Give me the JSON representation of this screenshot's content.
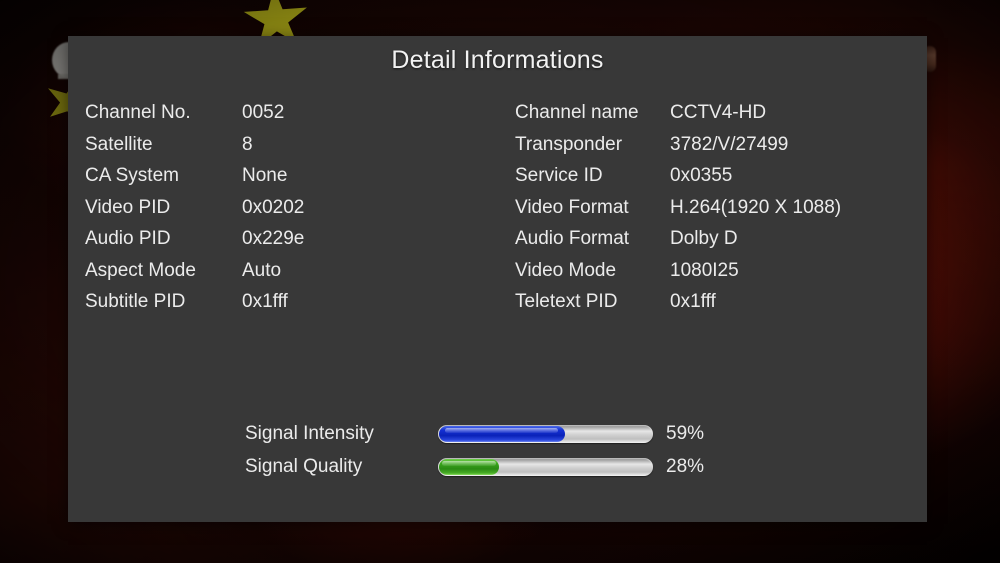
{
  "dialog": {
    "title": "Detail Informations"
  },
  "info": {
    "left": [
      {
        "label": "Channel No.",
        "value": "0052"
      },
      {
        "label": "Satellite",
        "value": "8"
      },
      {
        "label": "CA System",
        "value": "None"
      },
      {
        "label": "Video PID",
        "value": "0x0202"
      },
      {
        "label": "Audio PID",
        "value": "0x229e"
      },
      {
        "label": "Aspect Mode",
        "value": "Auto"
      },
      {
        "label": "Subtitle PID",
        "value": "0x1fff"
      }
    ],
    "right": [
      {
        "label": "Channel name",
        "value": "CCTV4-HD"
      },
      {
        "label": "Transponder",
        "value": "3782/V/27499"
      },
      {
        "label": "Service ID",
        "value": "0x0355"
      },
      {
        "label": "Video Format",
        "value": "H.264(1920 X 1088)"
      },
      {
        "label": "Audio Format",
        "value": "Dolby D"
      },
      {
        "label": "Video Mode",
        "value": "1080I25"
      },
      {
        "label": "Teletext PID",
        "value": "0x1fff"
      }
    ]
  },
  "signal": {
    "intensity": {
      "label": "Signal Intensity",
      "percent_text": "59%",
      "percent": 59,
      "color": "#1430d4"
    },
    "quality": {
      "label": "Signal Quality",
      "percent_text": "28%",
      "percent": 28,
      "color": "#3aa51c"
    }
  },
  "background": {
    "scene": "blurred-tv-picture-red-with-yellow-stars",
    "base_color": "#300a05",
    "star_color": "#d8d41e",
    "dialog_color": "#383838"
  }
}
